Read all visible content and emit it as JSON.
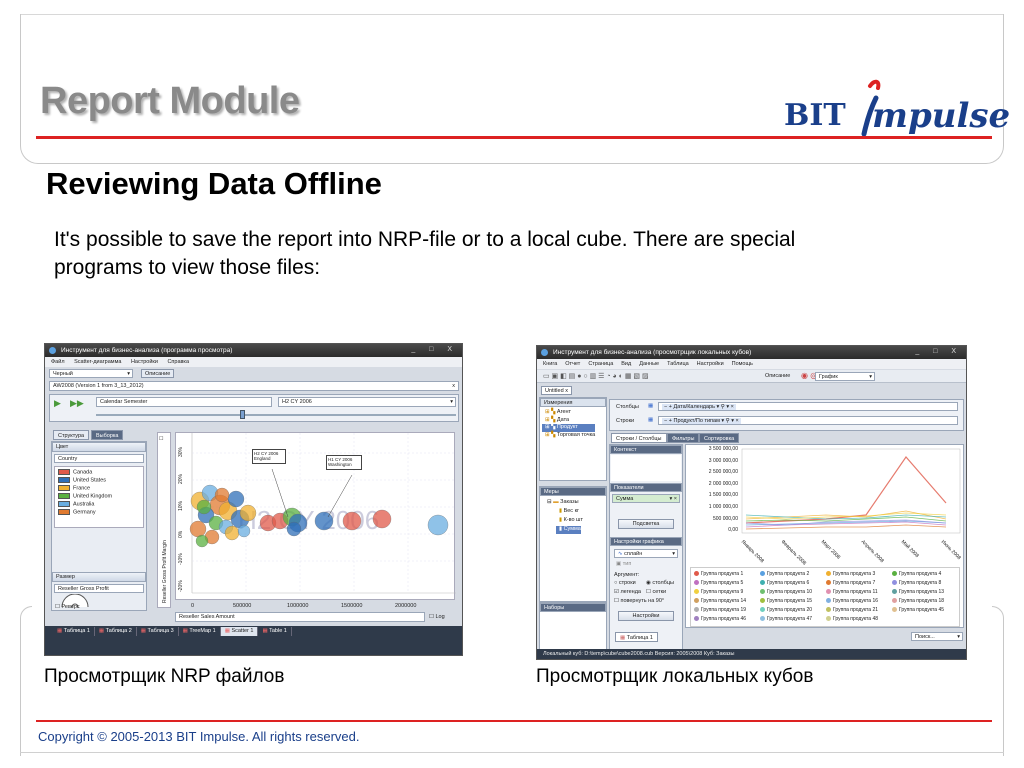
{
  "slide": {
    "title": "Report Module",
    "logo_bit": "BIT",
    "logo_impulse": "mpulse",
    "subtitle": "Reviewing Data Offline",
    "body": "It's possible to save the report into NRP-file or to a local cube. There are special programs to view those files:",
    "caption_left": "Просмотрщик NRP файлов",
    "caption_right": "Просмотрщик локальных кубов",
    "copyright": "Copyright © 2005-2013 BIT Impulse. All rights reserved.",
    "colors": {
      "accent_red": "#dd2222",
      "brand_blue": "#1a3f8a",
      "title_gray": "#8a8a8a"
    }
  },
  "nrp_viewer": {
    "window_title": "Инструмент для бизнес-анализа (программа просмотра)",
    "menu": [
      "Файл",
      "Scatter-диаграмма",
      "Настройки",
      "Справка"
    ],
    "style_select": "Черный",
    "description_tab": "Описание",
    "report_tab": "AW2008 (Version 1 from 3_13_2012)",
    "time_field": "Calendar Semester",
    "time_value": "H2 CY 2006",
    "panel_tabs": [
      "Структура",
      "Выборка"
    ],
    "color_header": "Цвет",
    "color_field": "Country",
    "countries": [
      {
        "name": "Canada",
        "color": "#e05a4a"
      },
      {
        "name": "United States",
        "color": "#2f6fb8"
      },
      {
        "name": "France",
        "color": "#f0b030"
      },
      {
        "name": "United Kingdom",
        "color": "#5ab040"
      },
      {
        "name": "Australia",
        "color": "#6aaee0"
      },
      {
        "name": "Germany",
        "color": "#e07a30"
      }
    ],
    "size_header": "Размер",
    "size_field": "Reseller Gross Profit",
    "reverse_label": "Реверс",
    "y_axis_label": "Reseller Gross Profit Margin",
    "y_ticks": [
      "30%",
      "20%",
      "10%",
      "0%",
      "-10%",
      "-20%"
    ],
    "x_ticks": [
      "0",
      "500000",
      "1000000",
      "1500000",
      "2000000"
    ],
    "x_axis_field": "Reseller Sales Amount",
    "log_label": "Log",
    "log_y_label": "Log",
    "watermark": "H2 CY 2006",
    "tooltips": [
      {
        "line1": "H2 CY 2006",
        "line2": "England"
      },
      {
        "line1": "H1 CY 2006",
        "line2": "Washington"
      }
    ],
    "bottom_tabs": [
      "Таблица 1",
      "Таблица 2",
      "Таблица 3",
      "TreeMap 1",
      "Scatter 1",
      "Table 1"
    ],
    "active_bottom_tab": "Scatter 1"
  },
  "cube_viewer": {
    "window_title": "Инструмент для бизнес-анализа (просмотрщик локальных кубов)",
    "menu": [
      "Книга",
      "Отчет",
      "Страница",
      "Вид",
      "Данные",
      "Таблица",
      "Настройки",
      "Помощь"
    ],
    "toolbar_description": "Описание",
    "toolbar_chart_select": "График",
    "doc_tab": "Untitled",
    "dimensions_header": "Измерения",
    "dimensions": [
      "Агент",
      "Дата",
      "Продукт",
      "Торговая точка"
    ],
    "selected_dimension": "Продукт",
    "columns_label": "Столбцы",
    "columns_value": "Дата/Календарь",
    "rows_label": "Строки",
    "rows_value": "Продукт/По типам",
    "view_tabs": [
      "Строки / Столбцы",
      "Фильтры",
      "Сортировка"
    ],
    "context_header": "Контекст",
    "measures_header": "Показатели",
    "measure_value": "Сумма",
    "highlight_button": "Подсветка",
    "chart_settings_header": "Настройки графика",
    "chart_style": "сплайн",
    "type_label": "тип",
    "argument_label": "Аргумент:",
    "argument_options": [
      "строки",
      "столбцы"
    ],
    "checkbox_options": [
      "легенда",
      "сетки",
      "повернуть на 90°"
    ],
    "settings_button": "Настройки",
    "measures_panel_header": "Меры",
    "orders_node": "Заказы",
    "measure_items": [
      "Вес кг",
      "К-во шт",
      "Сумма"
    ],
    "sets_header": "Наборы",
    "y_ticks": [
      "3 500 000,00",
      "3 000 000,00",
      "2 500 000,00",
      "2 000 000,00",
      "1 500 000,00",
      "1 000 000,00",
      "500 000,00",
      "0,00"
    ],
    "x_ticks": [
      "Январь 2008",
      "Февраль 2008",
      "Март 2008",
      "Апрель 2008",
      "Май 2008",
      "Июнь 2008"
    ],
    "legend": [
      "Группа продукта 1",
      "Группа продукта 2",
      "Группа продукта 3",
      "Группа продукта 4",
      "Группа продукта 5",
      "Группа продукта 6",
      "Группа продукта 7",
      "Группа продукта 8",
      "Группа продукта 9",
      "Группа продукта 10",
      "Группа продукта 11",
      "Группа продукта 13",
      "Группа продукта 14",
      "Группа продукта 15",
      "Группа продукта 16",
      "Группа продукта 18",
      "Группа продукта 19",
      "Группа продукта 20",
      "Группа продукта 21",
      "Группа продукта 45",
      "Группа продукта 46",
      "Группа продукта 47",
      "Группа продукта 48"
    ],
    "legend_colors": [
      "#e05a4a",
      "#5aa0e0",
      "#f0b030",
      "#5ab040",
      "#c070c0",
      "#40b0b0",
      "#e07a30",
      "#9090e0",
      "#f0d040",
      "#70c070",
      "#e090b0",
      "#60a0a0",
      "#d0a060",
      "#a0c040",
      "#80b0e0",
      "#e0a0a0",
      "#b0b0b0",
      "#70d0c0",
      "#c0c060",
      "#e0c090",
      "#a080c0",
      "#90c0e0",
      "#d0d090"
    ],
    "sheet_tab": "Таблица 1",
    "search_placeholder": "Поиск...",
    "status": "Локальный куб: D:\\temp\\cube\\cube2008.cub   Версия: 2005\\2008   Куб: Заказы"
  }
}
